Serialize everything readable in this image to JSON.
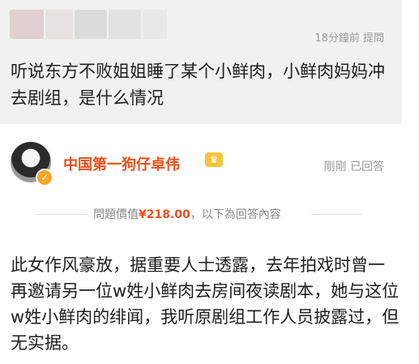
{
  "question": {
    "meta": "18分鐘前 提問",
    "text": "听说东方不败姐姐睡了某个小鲜肉，小鲜肉妈妈冲去剧组，是什么情况"
  },
  "answer": {
    "name": "中国第一狗仔卓伟",
    "badge_icon": "crown-icon",
    "meta": "剛剛 已回答",
    "price_prefix": "問題價值",
    "price": "¥218.00",
    "price_suffix": "，以下為回答內容",
    "text": "此女作风豪放，据重要人士透露，去年拍戏时曾一再邀请另一位w姓小鲜肉去房间夜读剧本，她与这位w姓小鲜肉的绯闻，我听原剧组工作人员披露过，但无实据。"
  },
  "colors": {
    "accent": "#e8501a",
    "meta": "#9a9a9a",
    "card_bg": "#f1f1f1"
  }
}
